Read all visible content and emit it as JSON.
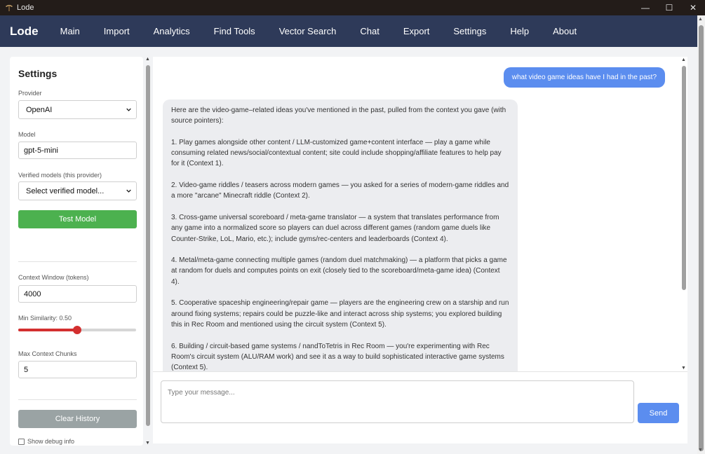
{
  "window": {
    "title": "Lode",
    "controls": {
      "minimize": "—",
      "maximize": "☐",
      "close": "✕"
    }
  },
  "nav": {
    "brand": "Lode",
    "items": [
      "Main",
      "Import",
      "Analytics",
      "Find Tools",
      "Vector Search",
      "Chat",
      "Export",
      "Settings",
      "Help",
      "About"
    ]
  },
  "sidebar": {
    "heading": "Settings",
    "provider_label": "Provider",
    "provider_value": "OpenAI",
    "model_label": "Model",
    "model_value": "gpt-5-mini",
    "verified_label": "Verified models (this provider)",
    "verified_value": "Select verified model...",
    "test_button": "Test Model",
    "context_window_label": "Context Window (tokens)",
    "context_window_value": "4000",
    "min_similarity_label": "Min Similarity: 0.50",
    "min_similarity_value": 0.5,
    "max_chunks_label": "Max Context Chunks",
    "max_chunks_value": "5",
    "clear_button": "Clear History",
    "debug_label": "Show debug info"
  },
  "chat": {
    "user_message": "what video game ideas have I had in the past?",
    "assistant_paragraphs": [
      "Here are the video-game–related ideas you've mentioned in the past, pulled from the context you gave (with source pointers):",
      "1. Play games alongside other content / LLM-customized game+content interface — play a game while consuming related news/social/contextual content; site could include shopping/affiliate features to help pay for it (Context 1).",
      "2. Video-game riddles / teasers across modern games — you asked for a series of modern-game riddles and a more \"arcane\" Minecraft riddle (Context 2).",
      "3. Cross-game universal scoreboard / meta-game translator — a system that translates performance from any game into a normalized score so players can duel across different games (random game duels like Counter-Strike, LoL, Mario, etc.); include gyms/rec-centers and leaderboards (Context 4).",
      "4. Metal/meta-game connecting multiple games (random duel matchmaking) — a platform that picks a game at random for duels and computes points on exit (closely tied to the scoreboard/meta-game idea) (Context 4).",
      "5. Cooperative spaceship engineering/repair game — players are the engineering crew on a starship and run around fixing systems; repairs could be puzzle-like and interact across ship systems; you explored building this in Rec Room and mentioned using the circuit system (Context 5).",
      "6. Building / circuit-based game systems / nandToTetris in Rec Room — you're experimenting with Rec Room's circuit system (ALU/RAM work) and see it as a way to build sophisticated interactive game systems (Context 5)."
    ],
    "input_placeholder": "Type your message...",
    "send_button": "Send"
  },
  "colors": {
    "nav_bg": "#2e3a59",
    "accent_blue": "#5b8def",
    "test_green": "#4cb14f",
    "slider_red": "#d32f2f",
    "clear_gray": "#9aa3a4"
  }
}
